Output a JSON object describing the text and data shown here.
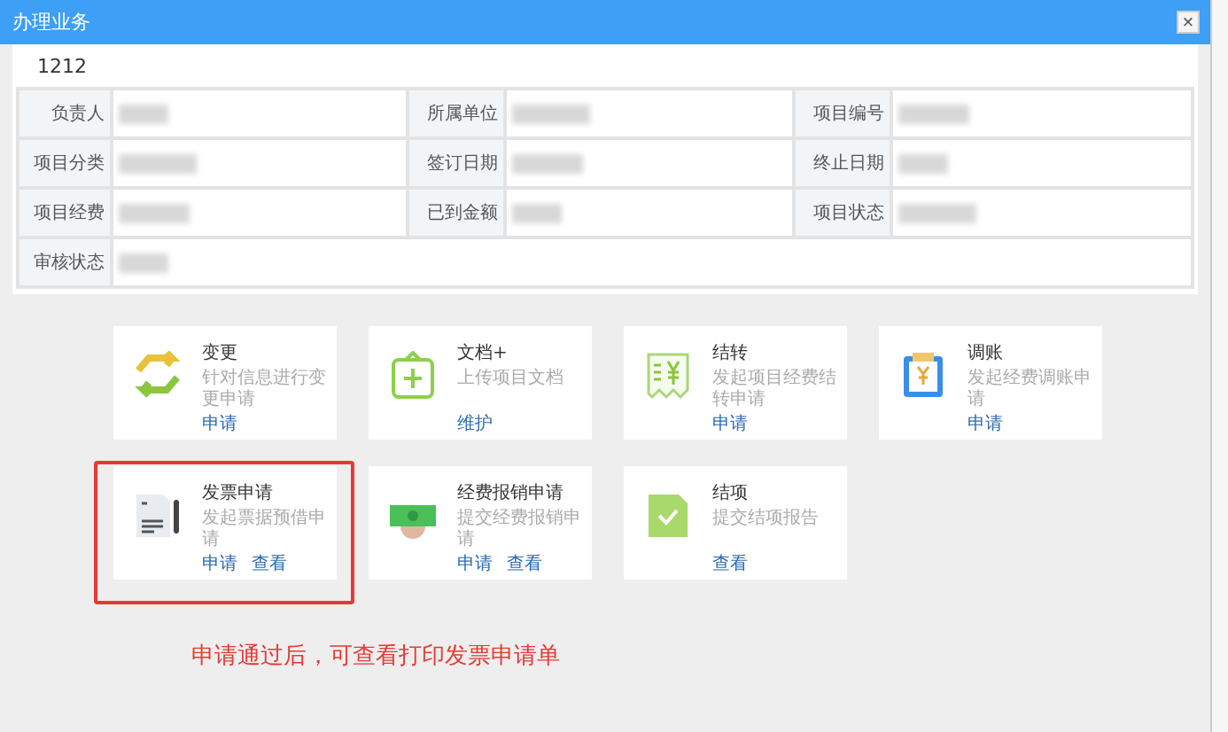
{
  "window": {
    "title": "办理业务",
    "close": "×"
  },
  "project_name": "1212",
  "info_rows": [
    [
      {
        "label": "负责人"
      },
      {
        "label": "所属单位"
      },
      {
        "label": "项目编号"
      }
    ],
    [
      {
        "label": "项目分类"
      },
      {
        "label": "签订日期"
      },
      {
        "label": "终止日期"
      }
    ],
    [
      {
        "label": "项目经费"
      },
      {
        "label": "已到金额"
      },
      {
        "label": "项目状态"
      }
    ],
    [
      {
        "label": "审核状态"
      }
    ]
  ],
  "cards": [
    {
      "kind": "swap",
      "title": "变更",
      "description": "针对信息进行变更申请",
      "links": [
        "申请"
      ],
      "highlighted": false
    },
    {
      "kind": "clipboard",
      "title": "文档+",
      "description": "上传项目文档",
      "links": [
        "维护"
      ],
      "highlighted": false
    },
    {
      "kind": "receipt",
      "title": "结转",
      "description": "发起项目经费结转申请",
      "links": [
        "申请"
      ],
      "highlighted": false
    },
    {
      "kind": "ledger",
      "title": "调账",
      "description": "发起经费调账申请",
      "links": [
        "申请"
      ],
      "highlighted": false
    },
    {
      "kind": "invoice",
      "title": "发票申请",
      "description": "发起票据预借申请",
      "links": [
        "申请",
        "查看"
      ],
      "highlighted": true
    },
    {
      "kind": "cash",
      "title": "经费报销申请",
      "description": "提交经费报销申请",
      "links": [
        "申请",
        "查看"
      ],
      "highlighted": false
    },
    {
      "kind": "check",
      "title": "结项",
      "description": "提交结项报告",
      "links": [
        "查看"
      ],
      "highlighted": false
    }
  ],
  "annotation": "申请通过后，可查看打印发票申请单"
}
